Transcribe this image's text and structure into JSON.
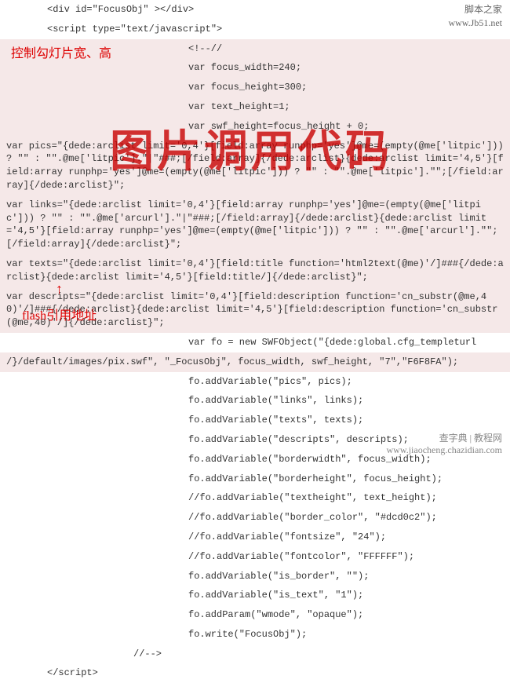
{
  "watermark_top": {
    "line1": "脚本之家",
    "line2": "www.Jb51.net"
  },
  "watermark_bottom": {
    "line1": "查字典 | 教程网",
    "line2": "www.jiaocheng.chazidian.com"
  },
  "annotations": {
    "slide_size": "控制勾灯片宽、高",
    "big_text": "图片调用代码",
    "flash_addr": "flash引用地址"
  },
  "code": {
    "l1": "<div id=\"FocusObj\" ></div>",
    "l2": "<script type=\"text/javascript\">",
    "l3": "<!--//",
    "l4": "var focus_width=240;",
    "l5": "var focus_height=300;",
    "l6": "var text_height=1;",
    "l7": "var swf_height=focus_height + 0;",
    "l8": "var pics=\"{dede:arclist limit='0,4'}[field:array runphp='yes']@me=(empty(@me['litpic'])) ? \"\" : \"\".@me['litpic'].\"|\"###;[/field:array]{/dede:arclist}{dede:arclist limit='4,5'}[field:array runphp='yes']@me=(empty(@me['litpic'])) ? \"\" : \"\".@me['litpic'].\"\";[/field:array]{/dede:arclist}\";",
    "l9": "var links=\"{dede:arclist limit='0,4'}[field:array runphp='yes']@me=(empty(@me['litpic'])) ? \"\" : \"\".@me['arcurl'].\"|\"###;[/field:array]{/dede:arclist}{dede:arclist limit='4,5'}[field:array runphp='yes']@me=(empty(@me['litpic'])) ? \"\" : \"\".@me['arcurl'].\"\";[/field:array]{/dede:arclist}\";",
    "l10": "var texts=\"{dede:arclist limit='0,4'}[field:title function='html2text(@me)'/]###{/dede:arclist}{dede:arclist limit='4,5'}[field:title/]{/dede:arclist}\";",
    "l11": "var descripts=\"{dede:arclist limit='0,4'}[field:description function='cn_substr(@me,40)'/]###{/dede:arclist}{dede:arclist limit='4,5'}[field:description function='cn_substr(@me,40)'/]{/dede:arclist}\";",
    "l12a": "var fo = new SWFObject(\"{dede:global.cfg_templeturl",
    "l12b": "/}/default/images/pix.swf\", \"_FocusObj\", focus_width, swf_height, \"7\",\"F6F8FA\");",
    "l13": "fo.addVariable(\"pics\", pics);",
    "l14": "fo.addVariable(\"links\", links);",
    "l15": "fo.addVariable(\"texts\", texts);",
    "l16": "fo.addVariable(\"descripts\", descripts);",
    "l17": "fo.addVariable(\"borderwidth\", focus_width);",
    "l18": "fo.addVariable(\"borderheight\", focus_height);",
    "l19": "//fo.addVariable(\"textheight\", text_height);",
    "l20": "//fo.addVariable(\"border_color\", \"#dcd0c2\");",
    "l21": "//fo.addVariable(\"fontsize\", \"24\");",
    "l22": "//fo.addVariable(\"fontcolor\", \"FFFFFF\");",
    "l23": "fo.addVariable(\"is_border\", \"\");",
    "l24": "fo.addVariable(\"is_text\", \"1\");",
    "l25": "fo.addParam(\"wmode\", \"opaque\");",
    "l26": "fo.write(\"FocusObj\");",
    "l27": "//-->",
    "l28": "</script>"
  }
}
